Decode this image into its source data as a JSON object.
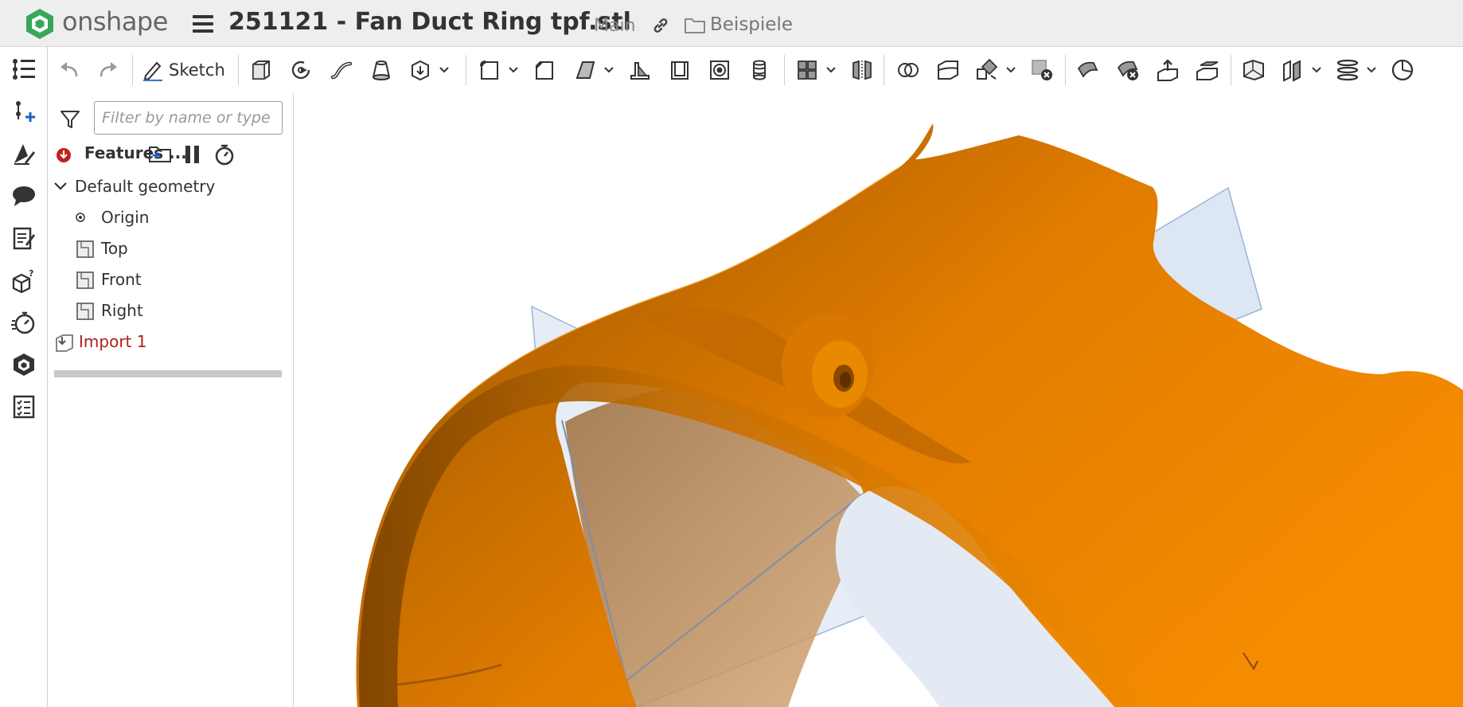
{
  "app": {
    "brand_name": "onshape",
    "document_title": "251121 - Fan Duct Ring tpf.stl",
    "branch": "Main",
    "folder": "Beispiele"
  },
  "toolbar": {
    "sketch_label": "Sketch"
  },
  "feature_panel": {
    "filter_placeholder": "Filter by name or type",
    "header_label": "Features ...",
    "tree": {
      "group_label": "Default geometry",
      "items": [
        {
          "label": "Origin",
          "icon": "origin-icon"
        },
        {
          "label": "Top",
          "icon": "plane-icon"
        },
        {
          "label": "Front",
          "icon": "plane-icon"
        },
        {
          "label": "Right",
          "icon": "plane-icon"
        }
      ],
      "import_label": "Import 1"
    }
  },
  "colors": {
    "brand_green": "#3aa65a",
    "model_orange": "#f08a00",
    "error_red": "#b0201c",
    "plane_blue": "#d9e3f2"
  }
}
